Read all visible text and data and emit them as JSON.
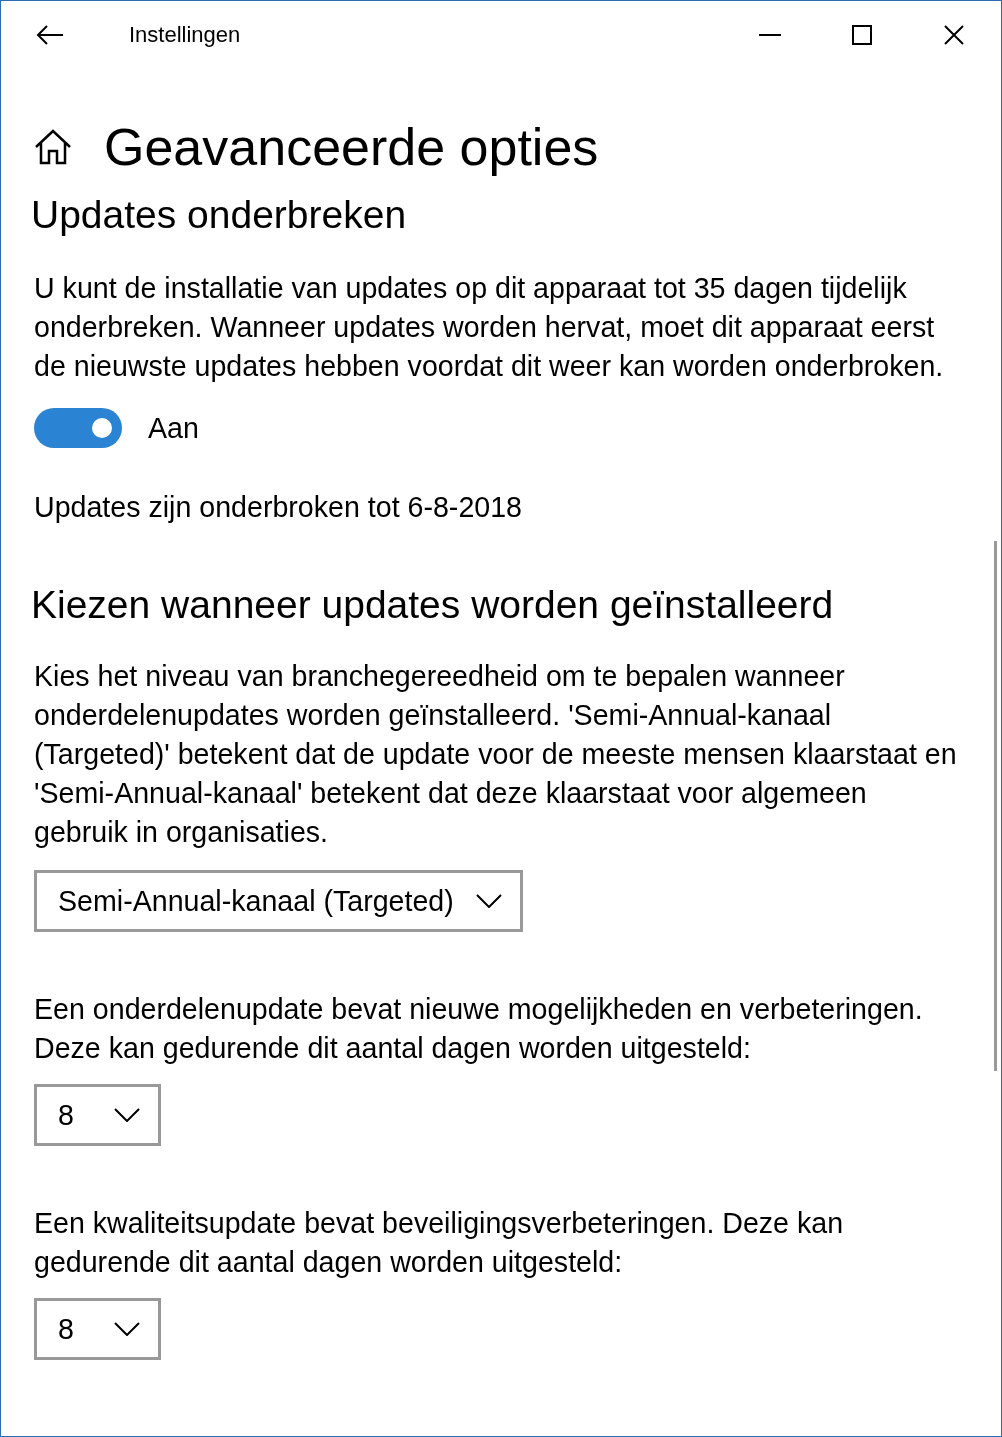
{
  "window": {
    "title": "Instellingen"
  },
  "page_title": "Geavanceerde opties",
  "pause": {
    "heading": "Updates onderbreken",
    "description": "U kunt de installatie van updates op dit apparaat tot 35 dagen tijdelijk onderbreken. Wanneer updates worden hervat, moet dit apparaat eerst de nieuwste updates hebben voordat dit weer kan worden onderbroken.",
    "toggle": {
      "on": true,
      "label": "Aan"
    },
    "status": "Updates zijn onderbroken tot 6-8-2018"
  },
  "channel": {
    "heading": "Kiezen wanneer updates worden geïnstalleerd",
    "description": "Kies het niveau van branchegereedheid om te bepalen wanneer onderdelenupdates worden geïnstalleerd. 'Semi-Annual-kanaal (Targeted)' betekent dat de update voor de meeste mensen klaarstaat en 'Semi-Annual-kanaal' betekent dat deze klaarstaat voor algemeen gebruik in organisaties.",
    "dropdown": {
      "value": "Semi-Annual-kanaal (Targeted)"
    }
  },
  "deferrals": [
    {
      "description": "Een onderdelenupdate bevat nieuwe mogelijkheden en verbeteringen. Deze kan gedurende dit aantal dagen worden uitgesteld:",
      "dropdown": {
        "value": "8"
      }
    },
    {
      "description": "Een kwaliteitsupdate bevat beveiligingsverbeteringen. Deze kan gedurende dit aantal dagen worden uitgesteld:",
      "dropdown": {
        "value": "8"
      }
    }
  ]
}
